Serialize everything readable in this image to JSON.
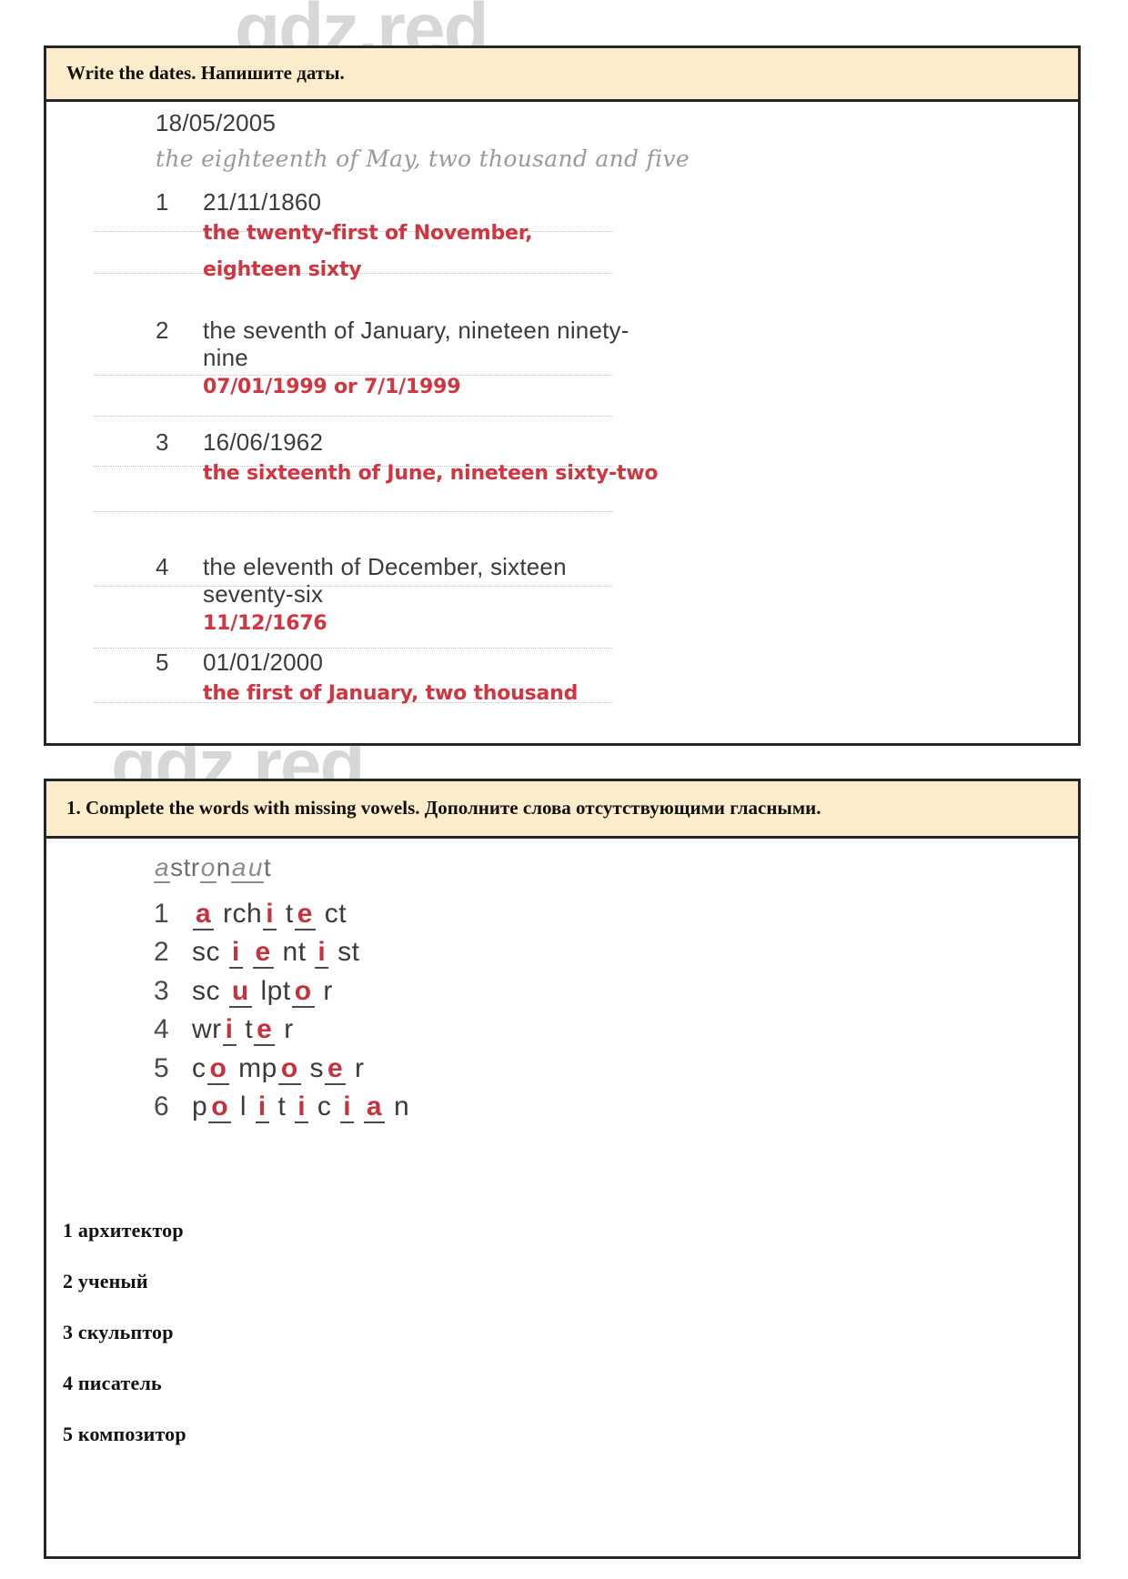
{
  "watermark": {
    "text": "gdz.red"
  },
  "colors": {
    "header_bg": "#fbeccb",
    "border": "#262626",
    "answer_red": "#d2353f",
    "scan_gray": "#3b3b3b"
  },
  "exercise_dates": {
    "header": "Write the dates. Напишите даты.",
    "example": {
      "prompt": "18/05/2005",
      "answer": "the eighteenth of May, two thousand and five"
    },
    "items": [
      {
        "num": "1",
        "question": "21/11/1860",
        "answer_line1": "the twenty-first of November,",
        "answer_line2": "eighteen sixty"
      },
      {
        "num": "2",
        "question_line1": "the seventh of January, nineteen ninety-",
        "question_line2": "nine",
        "answer_line1": "07/01/1999 or 7/1/1999",
        "answer_line2": ""
      },
      {
        "num": "3",
        "question": "16/06/1962",
        "answer_line1": "the sixteenth of June, nineteen sixty-two",
        "answer_line2": ""
      },
      {
        "num": "4",
        "question_line1": "the eleventh of December, sixteen",
        "question_line2": "seventy-six",
        "answer_line1": "11/12/1676",
        "answer_line2": ""
      },
      {
        "num": "5",
        "question": "01/01/2000",
        "answer_line1": "the first of January, two thousand",
        "answer_line2": ""
      }
    ]
  },
  "exercise_vowels": {
    "header": "1. Complete the words with missing vowels. Дополните слова отсутствующими гласными.",
    "example": {
      "word": "astronaut",
      "parts": [
        {
          "t": "a",
          "f": 1
        },
        {
          "t": "str",
          "f": 0
        },
        {
          "t": "o",
          "f": 1
        },
        {
          "t": "n",
          "f": 0
        },
        {
          "t": "a",
          "f": 1
        },
        {
          "t": "u",
          "f": 1
        },
        {
          "t": "t",
          "f": 0
        }
      ]
    },
    "items": [
      {
        "num": "1",
        "word": "architect",
        "parts": [
          {
            "t": "a",
            "r": 1
          },
          {
            "t": " rch",
            "r": 0
          },
          {
            "t": "i",
            "r": 1
          },
          {
            "t": " t",
            "r": 0
          },
          {
            "t": "e",
            "r": 1
          },
          {
            "t": " ct",
            "r": 0
          }
        ]
      },
      {
        "num": "2",
        "word": "scientist",
        "parts": [
          {
            "t": "sc ",
            "r": 0
          },
          {
            "t": "i",
            "r": 1
          },
          {
            "t": " ",
            "r": 0
          },
          {
            "t": "e",
            "r": 1
          },
          {
            "t": " nt ",
            "r": 0
          },
          {
            "t": "i",
            "r": 1
          },
          {
            "t": " st",
            "r": 0
          }
        ]
      },
      {
        "num": "3",
        "word": "sculptor",
        "parts": [
          {
            "t": "sc ",
            "r": 0
          },
          {
            "t": "u",
            "r": 1
          },
          {
            "t": " lpt",
            "r": 0
          },
          {
            "t": "o",
            "r": 1
          },
          {
            "t": " r",
            "r": 0
          }
        ]
      },
      {
        "num": "4",
        "word": "writer",
        "parts": [
          {
            "t": "wr",
            "r": 0
          },
          {
            "t": "i",
            "r": 1
          },
          {
            "t": " t",
            "r": 0
          },
          {
            "t": "e",
            "r": 1
          },
          {
            "t": " r",
            "r": 0
          }
        ]
      },
      {
        "num": "5",
        "word": "composer",
        "parts": [
          {
            "t": "c",
            "r": 0
          },
          {
            "t": "o",
            "r": 1
          },
          {
            "t": " mp",
            "r": 0
          },
          {
            "t": "o",
            "r": 1
          },
          {
            "t": " s",
            "r": 0
          },
          {
            "t": "e",
            "r": 1
          },
          {
            "t": " r",
            "r": 0
          }
        ]
      },
      {
        "num": "6",
        "word": "politician",
        "parts": [
          {
            "t": "p",
            "r": 0
          },
          {
            "t": "o",
            "r": 1
          },
          {
            "t": " l ",
            "r": 0
          },
          {
            "t": "i",
            "r": 1
          },
          {
            "t": " t ",
            "r": 0
          },
          {
            "t": "i",
            "r": 1
          },
          {
            "t": " c ",
            "r": 0
          },
          {
            "t": "i",
            "r": 1
          },
          {
            "t": " ",
            "r": 0
          },
          {
            "t": "a",
            "r": 1
          },
          {
            "t": " n",
            "r": 0
          }
        ]
      }
    ],
    "translations": [
      "1 архитектор",
      "2 ученый",
      "3 скульптор",
      "4 писатель",
      "5 композитор"
    ]
  }
}
